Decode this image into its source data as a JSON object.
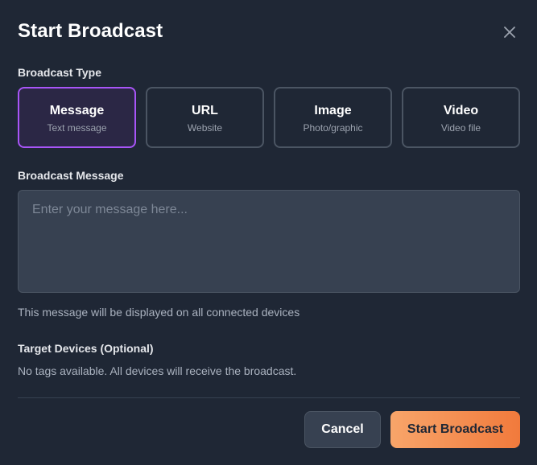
{
  "modal": {
    "title": "Start Broadcast",
    "close_icon": "close-icon"
  },
  "broadcast_type": {
    "label": "Broadcast Type",
    "selected": "Message",
    "options": [
      {
        "title": "Message",
        "subtitle": "Text message"
      },
      {
        "title": "URL",
        "subtitle": "Website"
      },
      {
        "title": "Image",
        "subtitle": "Photo/graphic"
      },
      {
        "title": "Video",
        "subtitle": "Video file"
      }
    ]
  },
  "message": {
    "label": "Broadcast Message",
    "placeholder": "Enter your message here...",
    "value": "",
    "help": "This message will be displayed on all connected devices"
  },
  "target_devices": {
    "label": "Target Devices (Optional)",
    "note": "No tags available. All devices will receive the broadcast."
  },
  "actions": {
    "cancel_label": "Cancel",
    "start_label": "Start Broadcast"
  },
  "colors": {
    "background": "#1f2735",
    "selected_border": "#a855f7",
    "primary_gradient_start": "#f8a56a",
    "primary_gradient_end": "#f17a3c"
  }
}
